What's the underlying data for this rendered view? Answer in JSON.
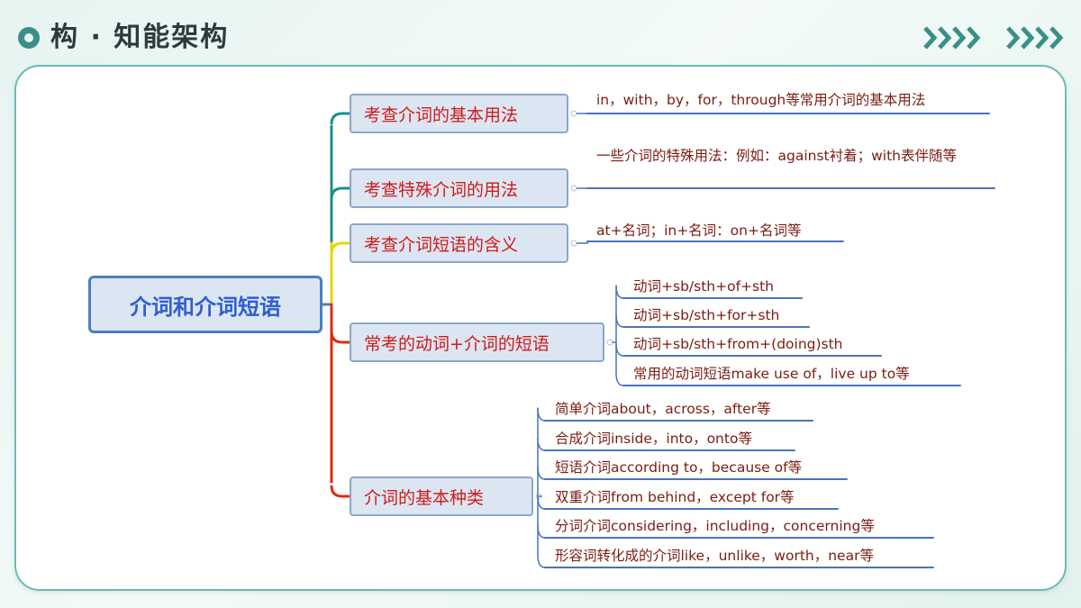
{
  "header": {
    "title": "构 · 知能架构"
  },
  "mindmap": {
    "root": "介词和介词短语",
    "branches": [
      {
        "label": "考查介词的基本用法",
        "children": [
          "in，with，by，for，through等常用介词的基本用法"
        ]
      },
      {
        "label": "考查特殊介词的用法",
        "children": [
          "一些介词的特殊用法：例如：against衬着；with表伴随等"
        ]
      },
      {
        "label": "考查介词短语的含义",
        "children": [
          "at+名词；in+名词：on+名词等"
        ]
      },
      {
        "label": "常考的动词+介词的短语",
        "children": [
          "动词+sb/sth+of+sth",
          "动词+sb/sth+for+sth",
          "动词+sb/sth+from+(doing)sth",
          "常用的动词短语make use of，live up to等"
        ]
      },
      {
        "label": "介词的基本种类",
        "children": [
          "简单介词about，across，after等",
          "合成介词inside，into，onto等",
          "短语介词according to，because of等",
          "双重介词from behind，except for等",
          "分词介词considering，including，concerning等",
          "形容词转化成的介词like，unlike，worth，near等"
        ]
      }
    ]
  },
  "colors": {
    "accent_teal": "#3a8f88",
    "branch_text": "#d11a1a",
    "leaf_text": "#7a1c12",
    "root_text": "#2f5fcf",
    "underline": "#4a74b8",
    "connector_teal": "#1f8c8c",
    "connector_yellow": "#e6d800",
    "connector_red": "#e02a10"
  }
}
